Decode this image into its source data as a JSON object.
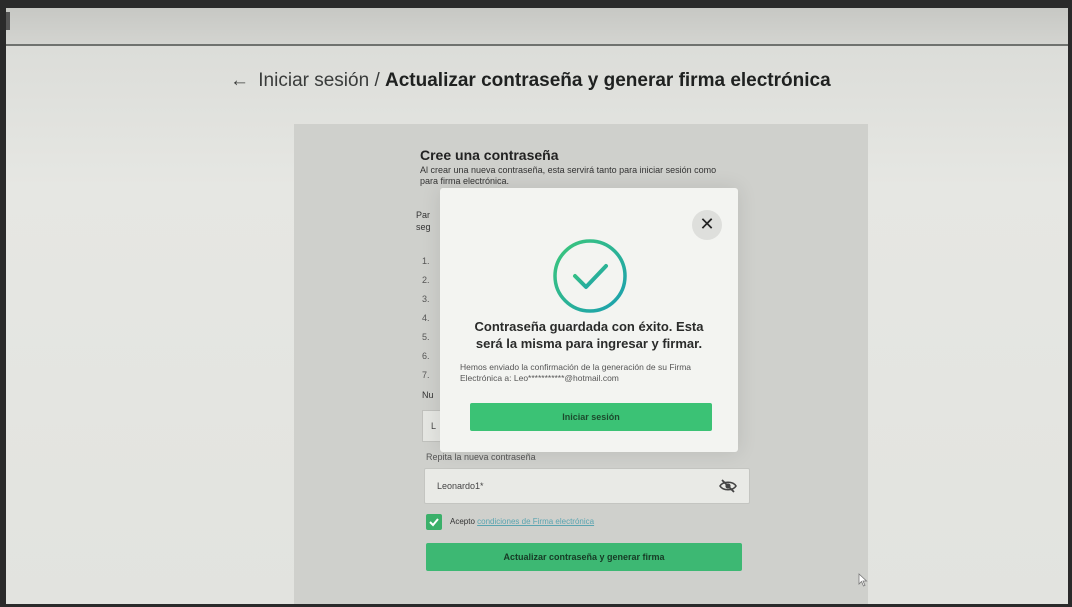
{
  "breadcrumb": {
    "back_arrow": "←",
    "parent": "Iniciar sesión",
    "separator": "/",
    "current": "Actualizar contraseña y generar firma electrónica"
  },
  "form": {
    "title": "Cree una contraseña",
    "description": "Al crear una nueva contraseña, esta servirá tanto para iniciar sesión como para firma electrónica.",
    "intro_line1": "Par",
    "intro_line2": "seg",
    "rules": [
      "1.",
      "2.",
      "3.",
      "4.",
      "5.",
      "6.",
      "7."
    ],
    "new_password_label": "Nu",
    "new_password_value": "L",
    "repeat_label": "Repita la nueva contraseña",
    "repeat_value": "Leonardo1*",
    "accept_prefix": "Acepto",
    "accept_link": "condiciones de Firma electrónica",
    "submit_label": "Actualizar contraseña y generar firma"
  },
  "modal": {
    "close_symbol": "✕",
    "title": "Contraseña guardada con éxito. Esta será la misma para ingresar y firmar.",
    "message": "Hemos enviado la confirmación de la generación de su Firma Electrónica a: Leo***********@hotmail.com",
    "button_label": "Iniciar sesión"
  },
  "colors": {
    "accent_green": "#3bc275",
    "success_teal": "#1fa8a0",
    "link_blue": "#5aa4b0"
  },
  "icons": {
    "back": "arrow-left-icon",
    "close": "close-icon",
    "success": "check-circle-icon",
    "eye": "eye-slash-icon",
    "checkbox": "checkmark-icon",
    "cursor": "mouse-pointer-icon"
  }
}
